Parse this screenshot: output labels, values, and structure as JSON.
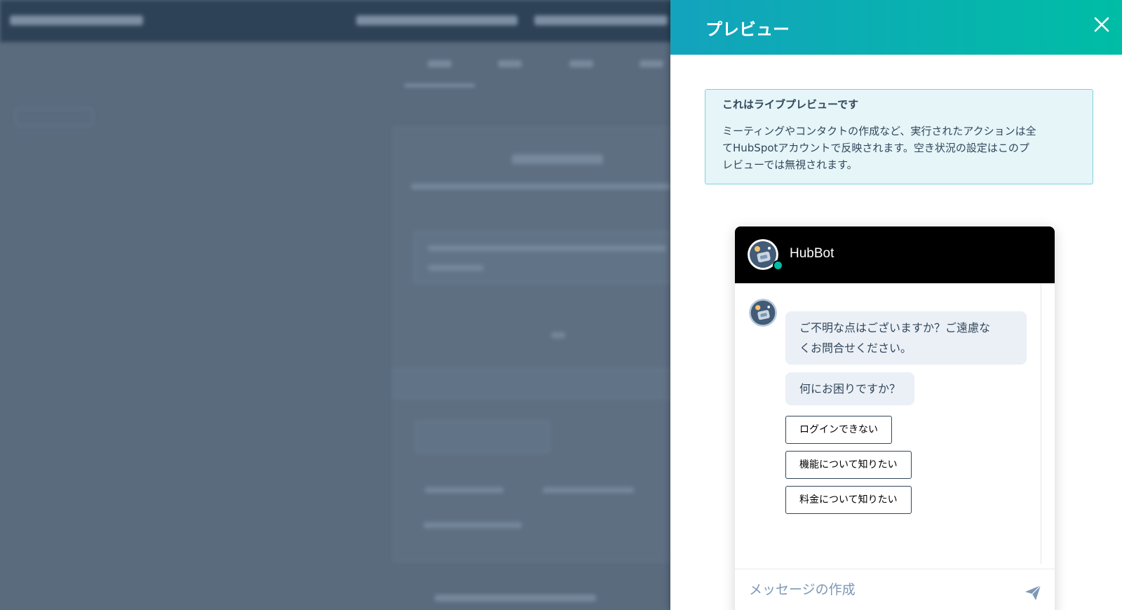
{
  "preview_panel": {
    "title": "プレビュー",
    "close_icon": "close-icon",
    "header_gradient": [
      "#13a3bd",
      "#00bda5"
    ]
  },
  "info_box": {
    "title": "これはライブプレビューです",
    "lines": [
      "ミーティングやコンタクトの作成など、実行されたアクションは全",
      "てHubSpotアカウントで反映されます。空き状況の設定はこの",
      "プレビューでは無視されます。"
    ],
    "line2_tail": "プ",
    "line3_head": "レビューでは無視されます。"
  },
  "chat": {
    "bot_name": "HubBot",
    "status": "online",
    "status_color": "#00bda5",
    "messages": [
      [
        "ご不明な点はございますか？ご遠慮な",
        "くお問合せください。"
      ],
      [
        "何にお困りですか？"
      ]
    ],
    "quick_replies": [
      "ログインできない",
      "機能について知りたい",
      "料金について知りたい"
    ],
    "composer_placeholder": "メッセージの作成",
    "send_icon": "send-icon"
  }
}
